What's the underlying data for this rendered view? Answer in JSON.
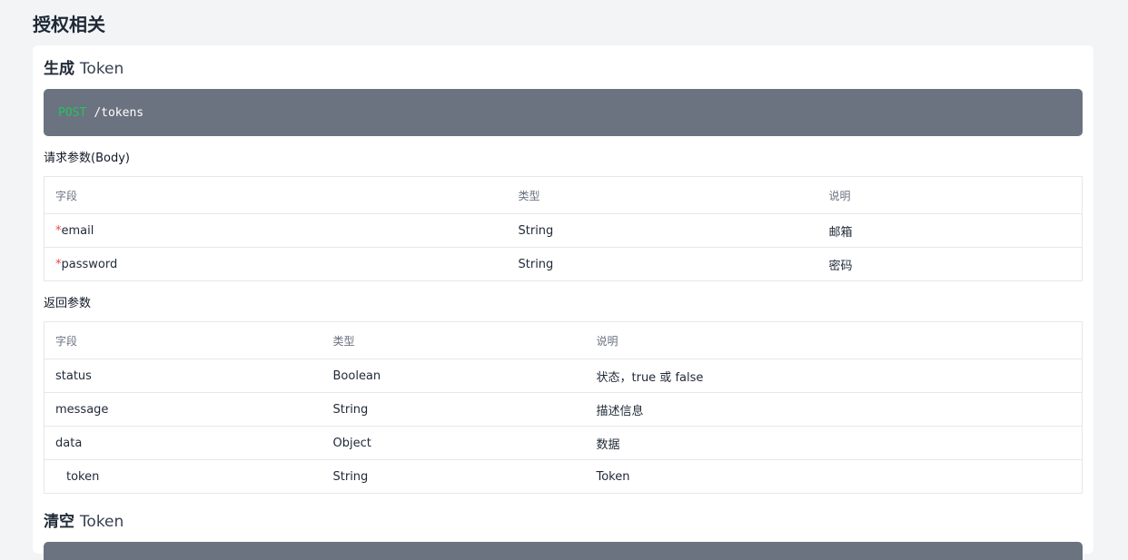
{
  "page": {
    "title": "授权相关"
  },
  "sections": [
    {
      "title_cn": "生成",
      "title_en": "Token",
      "method": "POST",
      "path": "/tokens",
      "request": {
        "heading": "请求参数(Body)",
        "headers": [
          "字段",
          "类型",
          "说明"
        ],
        "rows": [
          {
            "required": "*",
            "field": "email",
            "type": "String",
            "desc": "邮箱"
          },
          {
            "required": "*",
            "field": "password",
            "type": "String",
            "desc": "密码"
          }
        ]
      },
      "response": {
        "heading": "返回参数",
        "headers": [
          "字段",
          "类型",
          "说明"
        ],
        "rows": [
          {
            "field": "status",
            "type": "Boolean",
            "desc": "状态，true 或 false"
          },
          {
            "field": "message",
            "type": "String",
            "desc": "描述信息"
          },
          {
            "field": "data",
            "type": "Object",
            "desc": "数据"
          },
          {
            "field": "token",
            "type": "String",
            "desc": "Token"
          }
        ]
      }
    },
    {
      "title_cn": "清空",
      "title_en": "Token"
    }
  ],
  "colors": {
    "background": "#f3f4f6",
    "code_bg": "#6b7280",
    "method": "#22c55e",
    "required": "#ef4444"
  }
}
